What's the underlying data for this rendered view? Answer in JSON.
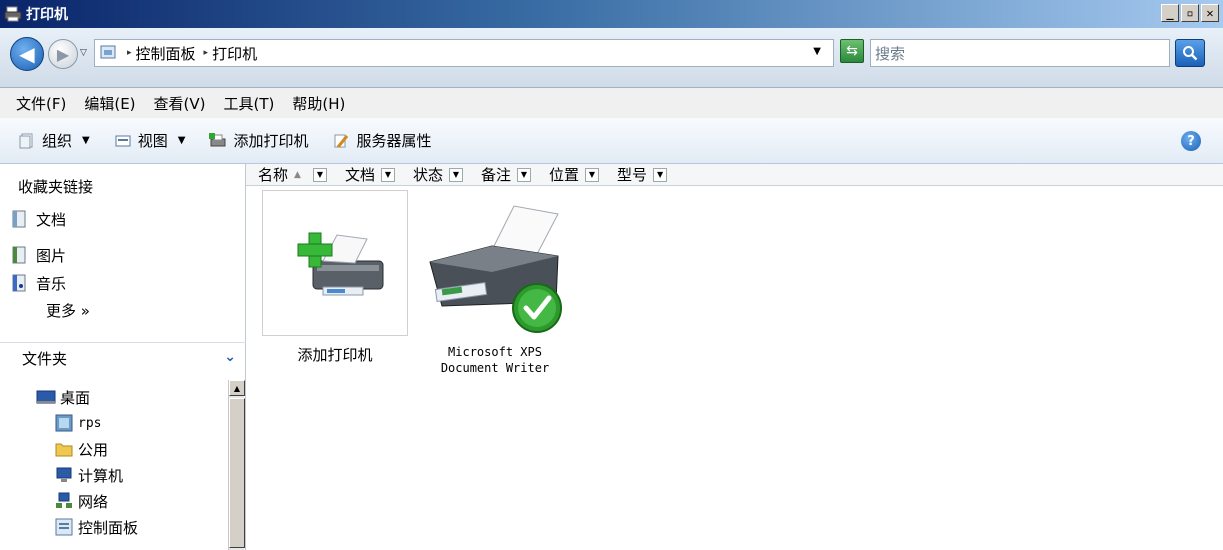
{
  "window": {
    "title": "打印机"
  },
  "address": {
    "segments": [
      "控制面板",
      "打印机"
    ],
    "search_placeholder": "搜索"
  },
  "menu": [
    "文件(F)",
    "编辑(E)",
    "查看(V)",
    "工具(T)",
    "帮助(H)"
  ],
  "toolbar": {
    "organize": "组织",
    "views": "视图",
    "add_printer": "添加打印机",
    "server_properties": "服务器属性"
  },
  "navpane": {
    "favorites_title": "收藏夹链接",
    "favorites": [
      "文档",
      "图片",
      "音乐"
    ],
    "more": "更多 »",
    "folders_title": "文件夹",
    "tree": [
      "桌面",
      "rps",
      "公用",
      "计算机",
      "网络",
      "控制面板"
    ]
  },
  "columns": [
    "名称",
    "文档",
    "状态",
    "备注",
    "位置",
    "型号"
  ],
  "items": [
    {
      "label": "添加打印机"
    },
    {
      "label_line1": "Microsoft XPS",
      "label_line2": "Document Writer"
    }
  ]
}
